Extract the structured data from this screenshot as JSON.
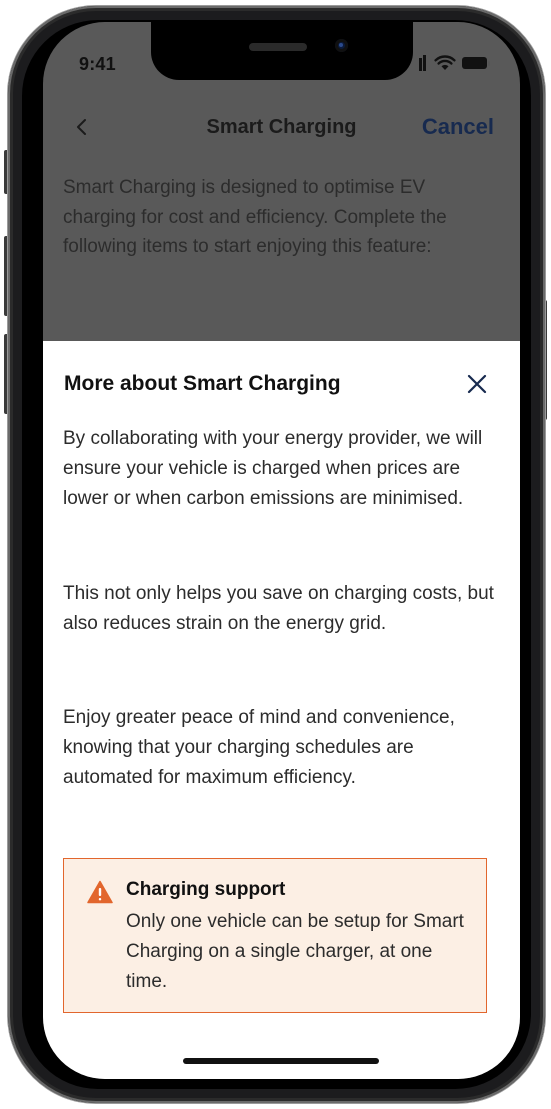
{
  "status_bar": {
    "time": "9:41"
  },
  "nav": {
    "title": "Smart Charging",
    "cancel_label": "Cancel"
  },
  "intro": "Smart Charging is designed to optimise EV charging for cost and efficiency. Complete the following items to start enjoying this feature:",
  "sheet": {
    "title": "More about Smart Charging",
    "paragraphs": [
      "By collaborating with your energy provider, we will ensure your vehicle is charged when prices are lower or when carbon emissions are minimised.",
      "This not only helps you save on charging costs, but also reduces strain on the energy grid.",
      "Enjoy greater peace of mind and convenience, knowing that your charging schedules are automated for maximum efficiency."
    ],
    "alert": {
      "title": "Charging support",
      "body": "Only one vehicle can be setup for Smart Charging on a single charger, at one time."
    }
  },
  "colors": {
    "overlay": "#595959",
    "accent": "#172a4f",
    "warning": "#e2662d",
    "alert_background": "#fcefe4"
  },
  "icons": [
    "back-chevron-icon",
    "close-icon",
    "warning-icon",
    "signal-icon",
    "wifi-icon",
    "battery-icon"
  ]
}
